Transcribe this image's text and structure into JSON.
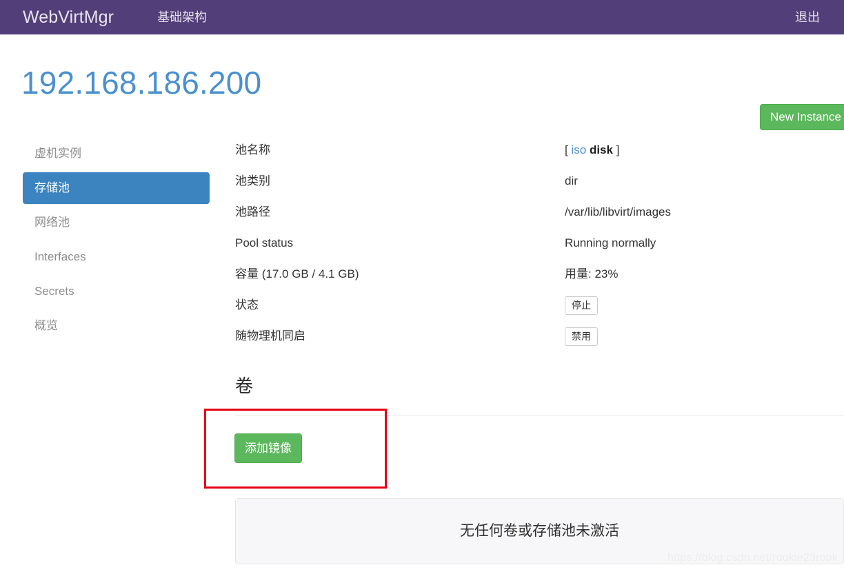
{
  "navbar": {
    "brand": "WebVirtMgr",
    "links": [
      {
        "label": "基础架构",
        "name": "nav-link-infrastructure"
      }
    ],
    "logout_label": "退出",
    "background_color": "#523e78"
  },
  "header": {
    "host_title": "192.168.186.200",
    "host_title_color": "#4a90cf",
    "new_instance_label": "New Instance",
    "new_instance_color": "#5cb85c"
  },
  "sidebar": {
    "items": [
      {
        "label": "虚机实例",
        "name": "sidebar-item-instances",
        "active": false
      },
      {
        "label": "存储池",
        "name": "sidebar-item-storages",
        "active": true
      },
      {
        "label": "网络池",
        "name": "sidebar-item-networks",
        "active": false
      },
      {
        "label": "Interfaces",
        "name": "sidebar-item-interfaces",
        "active": false
      },
      {
        "label": "Secrets",
        "name": "sidebar-item-secrets",
        "active": false
      },
      {
        "label": "概览",
        "name": "sidebar-item-overview",
        "active": false
      }
    ],
    "active_color": "#3c84c0"
  },
  "detail": {
    "pool_name_label": "池名称",
    "pool_name_bracket_open": "[",
    "pool_name_link": "iso",
    "pool_name_bold": "disk",
    "pool_name_bracket_close": "]",
    "pool_type_label": "池类别",
    "pool_type_value": "dir",
    "pool_path_label": "池路径",
    "pool_path_value": "/var/lib/libvirt/images",
    "pool_status_label": "Pool status",
    "pool_status_value": "Running normally",
    "capacity_label": "容量 (17.0 GB / 4.1 GB)",
    "capacity_value": "用量: 23%",
    "state_label": "状态",
    "state_button": "停止",
    "autostart_label": "随物理机同启",
    "autostart_button": "禁用"
  },
  "volumes": {
    "title": "卷",
    "add_image_label": "添加镜像",
    "add_image_color": "#5cb85c",
    "empty_message": "无任何卷或存储池未激活",
    "highlight_color": "#e60012"
  },
  "watermark": {
    "text": "https://blog.csdn.net/rookie23rook"
  }
}
